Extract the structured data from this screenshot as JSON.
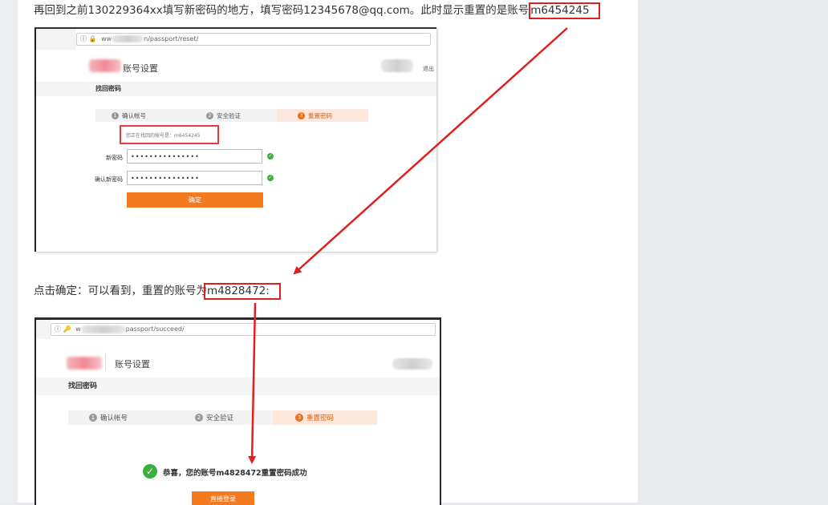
{
  "article": {
    "para1": "再回到之前130229364xx填写新密码的地方，填写密码12345678@qq.com。此时显示重置的是账号",
    "para1_account": "m6454245",
    "para2": "点击确定：可以看到，重置的账号为",
    "para2_account": "m4828472:"
  },
  "shot1": {
    "url_prefix": "ww",
    "url_path": "n/passport/reset/",
    "site_title": "账号设置",
    "header_right": "退出",
    "subheader": "找回密码",
    "steps": [
      {
        "num": "1",
        "label": "确认帐号"
      },
      {
        "num": "2",
        "label": "安全验证"
      },
      {
        "num": "3",
        "label": "重置密码"
      }
    ],
    "notice": "您正在找回的帐号是：m6454245",
    "new_password_label": "新密码",
    "new_password_value": "•••••••••••••••",
    "confirm_password_label": "确认新密码",
    "confirm_password_value": "•••••••••••••••",
    "confirm_button": "确定"
  },
  "shot2": {
    "url_prefix": "w",
    "url_path": "passport/succeed/",
    "site_title": "账号设置",
    "subheader": "找回密码",
    "steps": [
      {
        "num": "1",
        "label": "确认帐号"
      },
      {
        "num": "2",
        "label": "安全验证"
      },
      {
        "num": "3",
        "label": "重置密码"
      }
    ],
    "success_message": "恭喜，您的账号m4828472重置密码成功",
    "login_button": "直接登录"
  },
  "colors": {
    "highlight": "#e02020",
    "accent": "#f47a20",
    "success": "#3dae3d",
    "active_step_bg": "#fde7dc"
  }
}
